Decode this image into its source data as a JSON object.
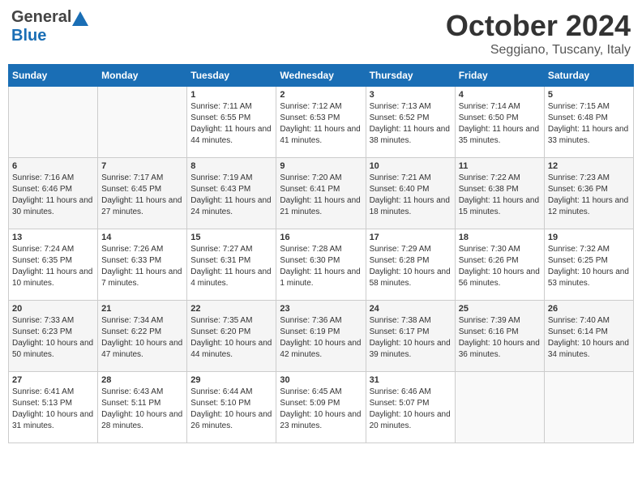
{
  "logo": {
    "general": "General",
    "blue": "Blue"
  },
  "title": "October 2024",
  "location": "Seggiano, Tuscany, Italy",
  "days_of_week": [
    "Sunday",
    "Monday",
    "Tuesday",
    "Wednesday",
    "Thursday",
    "Friday",
    "Saturday"
  ],
  "weeks": [
    [
      {
        "day": "",
        "info": ""
      },
      {
        "day": "",
        "info": ""
      },
      {
        "day": "1",
        "info": "Sunrise: 7:11 AM\nSunset: 6:55 PM\nDaylight: 11 hours and 44 minutes."
      },
      {
        "day": "2",
        "info": "Sunrise: 7:12 AM\nSunset: 6:53 PM\nDaylight: 11 hours and 41 minutes."
      },
      {
        "day": "3",
        "info": "Sunrise: 7:13 AM\nSunset: 6:52 PM\nDaylight: 11 hours and 38 minutes."
      },
      {
        "day": "4",
        "info": "Sunrise: 7:14 AM\nSunset: 6:50 PM\nDaylight: 11 hours and 35 minutes."
      },
      {
        "day": "5",
        "info": "Sunrise: 7:15 AM\nSunset: 6:48 PM\nDaylight: 11 hours and 33 minutes."
      }
    ],
    [
      {
        "day": "6",
        "info": "Sunrise: 7:16 AM\nSunset: 6:46 PM\nDaylight: 11 hours and 30 minutes."
      },
      {
        "day": "7",
        "info": "Sunrise: 7:17 AM\nSunset: 6:45 PM\nDaylight: 11 hours and 27 minutes."
      },
      {
        "day": "8",
        "info": "Sunrise: 7:19 AM\nSunset: 6:43 PM\nDaylight: 11 hours and 24 minutes."
      },
      {
        "day": "9",
        "info": "Sunrise: 7:20 AM\nSunset: 6:41 PM\nDaylight: 11 hours and 21 minutes."
      },
      {
        "day": "10",
        "info": "Sunrise: 7:21 AM\nSunset: 6:40 PM\nDaylight: 11 hours and 18 minutes."
      },
      {
        "day": "11",
        "info": "Sunrise: 7:22 AM\nSunset: 6:38 PM\nDaylight: 11 hours and 15 minutes."
      },
      {
        "day": "12",
        "info": "Sunrise: 7:23 AM\nSunset: 6:36 PM\nDaylight: 11 hours and 12 minutes."
      }
    ],
    [
      {
        "day": "13",
        "info": "Sunrise: 7:24 AM\nSunset: 6:35 PM\nDaylight: 11 hours and 10 minutes."
      },
      {
        "day": "14",
        "info": "Sunrise: 7:26 AM\nSunset: 6:33 PM\nDaylight: 11 hours and 7 minutes."
      },
      {
        "day": "15",
        "info": "Sunrise: 7:27 AM\nSunset: 6:31 PM\nDaylight: 11 hours and 4 minutes."
      },
      {
        "day": "16",
        "info": "Sunrise: 7:28 AM\nSunset: 6:30 PM\nDaylight: 11 hours and 1 minute."
      },
      {
        "day": "17",
        "info": "Sunrise: 7:29 AM\nSunset: 6:28 PM\nDaylight: 10 hours and 58 minutes."
      },
      {
        "day": "18",
        "info": "Sunrise: 7:30 AM\nSunset: 6:26 PM\nDaylight: 10 hours and 56 minutes."
      },
      {
        "day": "19",
        "info": "Sunrise: 7:32 AM\nSunset: 6:25 PM\nDaylight: 10 hours and 53 minutes."
      }
    ],
    [
      {
        "day": "20",
        "info": "Sunrise: 7:33 AM\nSunset: 6:23 PM\nDaylight: 10 hours and 50 minutes."
      },
      {
        "day": "21",
        "info": "Sunrise: 7:34 AM\nSunset: 6:22 PM\nDaylight: 10 hours and 47 minutes."
      },
      {
        "day": "22",
        "info": "Sunrise: 7:35 AM\nSunset: 6:20 PM\nDaylight: 10 hours and 44 minutes."
      },
      {
        "day": "23",
        "info": "Sunrise: 7:36 AM\nSunset: 6:19 PM\nDaylight: 10 hours and 42 minutes."
      },
      {
        "day": "24",
        "info": "Sunrise: 7:38 AM\nSunset: 6:17 PM\nDaylight: 10 hours and 39 minutes."
      },
      {
        "day": "25",
        "info": "Sunrise: 7:39 AM\nSunset: 6:16 PM\nDaylight: 10 hours and 36 minutes."
      },
      {
        "day": "26",
        "info": "Sunrise: 7:40 AM\nSunset: 6:14 PM\nDaylight: 10 hours and 34 minutes."
      }
    ],
    [
      {
        "day": "27",
        "info": "Sunrise: 6:41 AM\nSunset: 5:13 PM\nDaylight: 10 hours and 31 minutes."
      },
      {
        "day": "28",
        "info": "Sunrise: 6:43 AM\nSunset: 5:11 PM\nDaylight: 10 hours and 28 minutes."
      },
      {
        "day": "29",
        "info": "Sunrise: 6:44 AM\nSunset: 5:10 PM\nDaylight: 10 hours and 26 minutes."
      },
      {
        "day": "30",
        "info": "Sunrise: 6:45 AM\nSunset: 5:09 PM\nDaylight: 10 hours and 23 minutes."
      },
      {
        "day": "31",
        "info": "Sunrise: 6:46 AM\nSunset: 5:07 PM\nDaylight: 10 hours and 20 minutes."
      },
      {
        "day": "",
        "info": ""
      },
      {
        "day": "",
        "info": ""
      }
    ]
  ]
}
